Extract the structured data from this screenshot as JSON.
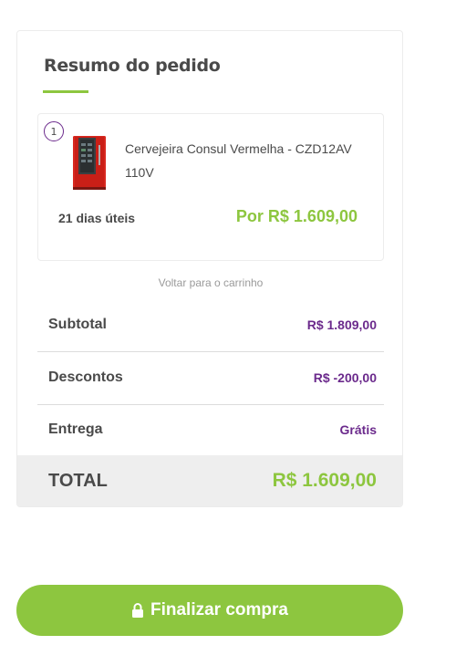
{
  "summary": {
    "title": "Resumo do pedido",
    "item": {
      "quantity": "1",
      "name": "Cervejeira Consul Vermelha - CZD12AV 110V",
      "delivery": "21 dias úteis",
      "price": "Por R$ 1.609,00",
      "image_icon": "product-thumbnail"
    },
    "back_link": "Voltar para o carrinho",
    "rows": [
      {
        "label": "Subtotal",
        "value": "R$ 1.809,00"
      },
      {
        "label": "Descontos",
        "value": "R$ -200,00"
      },
      {
        "label": "Entrega",
        "value": "Grátis"
      }
    ],
    "total": {
      "label": "TOTAL",
      "value": "R$ 1.609,00"
    }
  },
  "checkout": {
    "label": "Finalizar compra",
    "icon": "lock-icon"
  },
  "colors": {
    "accent_green": "#8dc63f",
    "accent_purple": "#6b2a8c",
    "text_dark": "#4a4a4a",
    "text_muted": "#9a9a9a",
    "total_bg": "#eeeeee"
  }
}
